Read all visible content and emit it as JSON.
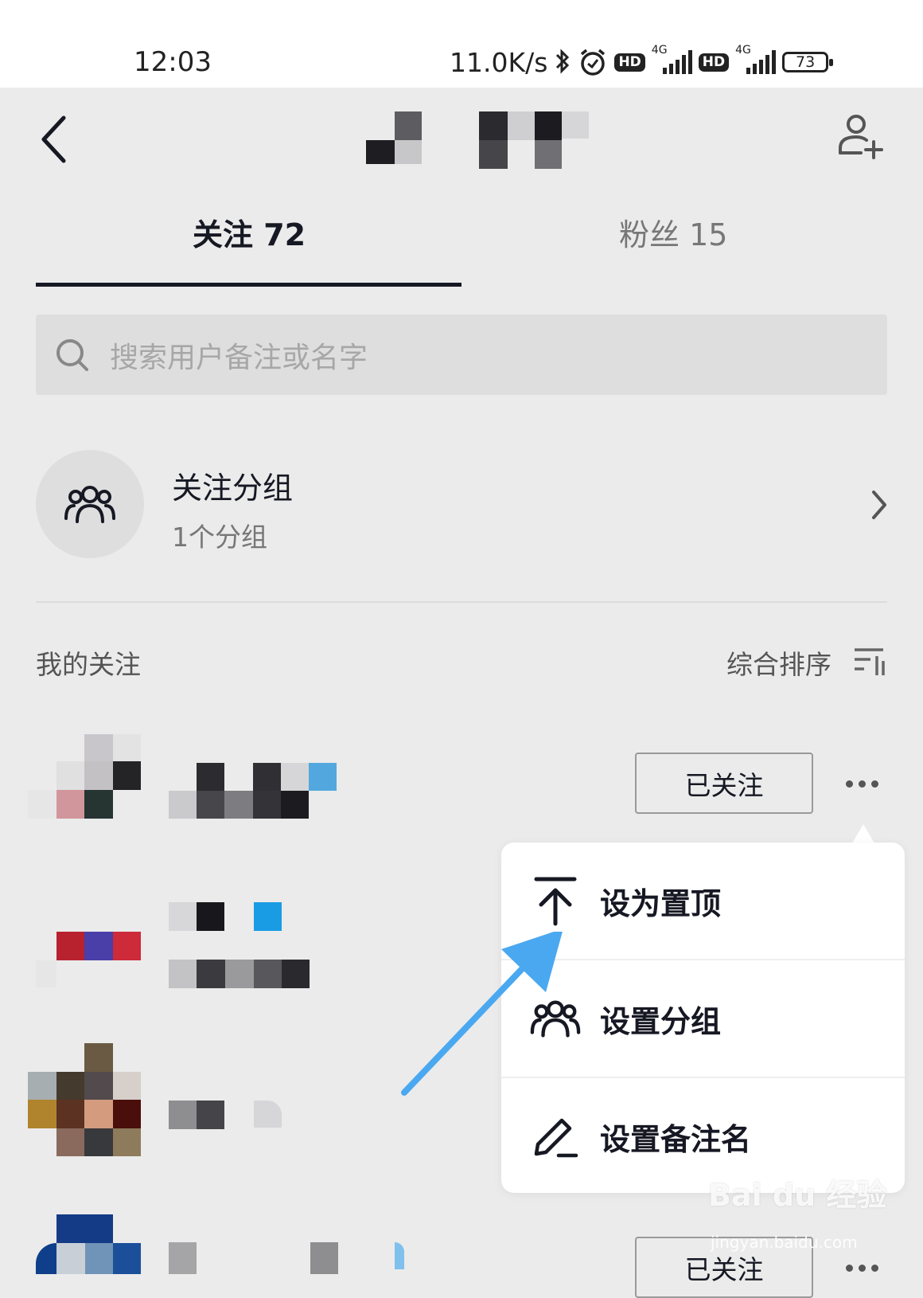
{
  "status_bar": {
    "time": "12:03",
    "speed": "11.0K/s",
    "hd1": "HD",
    "net1": "4G",
    "hd2": "HD",
    "net2": "4G",
    "battery": "73"
  },
  "header": {
    "back_icon": "chevron-left-icon",
    "add_friend_icon": "add-user-icon"
  },
  "tabs": [
    {
      "label": "关注 72",
      "active": true
    },
    {
      "label": "粉丝 15",
      "active": false
    }
  ],
  "search": {
    "placeholder": "搜索用户备注或名字",
    "icon": "search-icon"
  },
  "group": {
    "title": "关注分组",
    "subtitle": "1个分组",
    "icon": "group-icon"
  },
  "section": {
    "title": "我的关注",
    "sort_label": "综合排序",
    "sort_icon": "sort-icon"
  },
  "list": [
    {
      "button": "已关注",
      "more_icon": "more-dots-icon"
    },
    {
      "button": "已关注",
      "more_icon": "more-dots-icon"
    }
  ],
  "menu": [
    {
      "label": "设为置顶",
      "icon": "pin-top-icon"
    },
    {
      "label": "设置分组",
      "icon": "group-icon"
    },
    {
      "label": "设置备注名",
      "icon": "pencil-icon"
    }
  ],
  "watermark": {
    "brand": "Bai du 经验",
    "url": "jingyan.baidu.com"
  },
  "colors": {
    "background": "#ebebeb",
    "text": "#161823",
    "arrow": "#4aa8f0",
    "menu_bg": "#ffffff"
  }
}
